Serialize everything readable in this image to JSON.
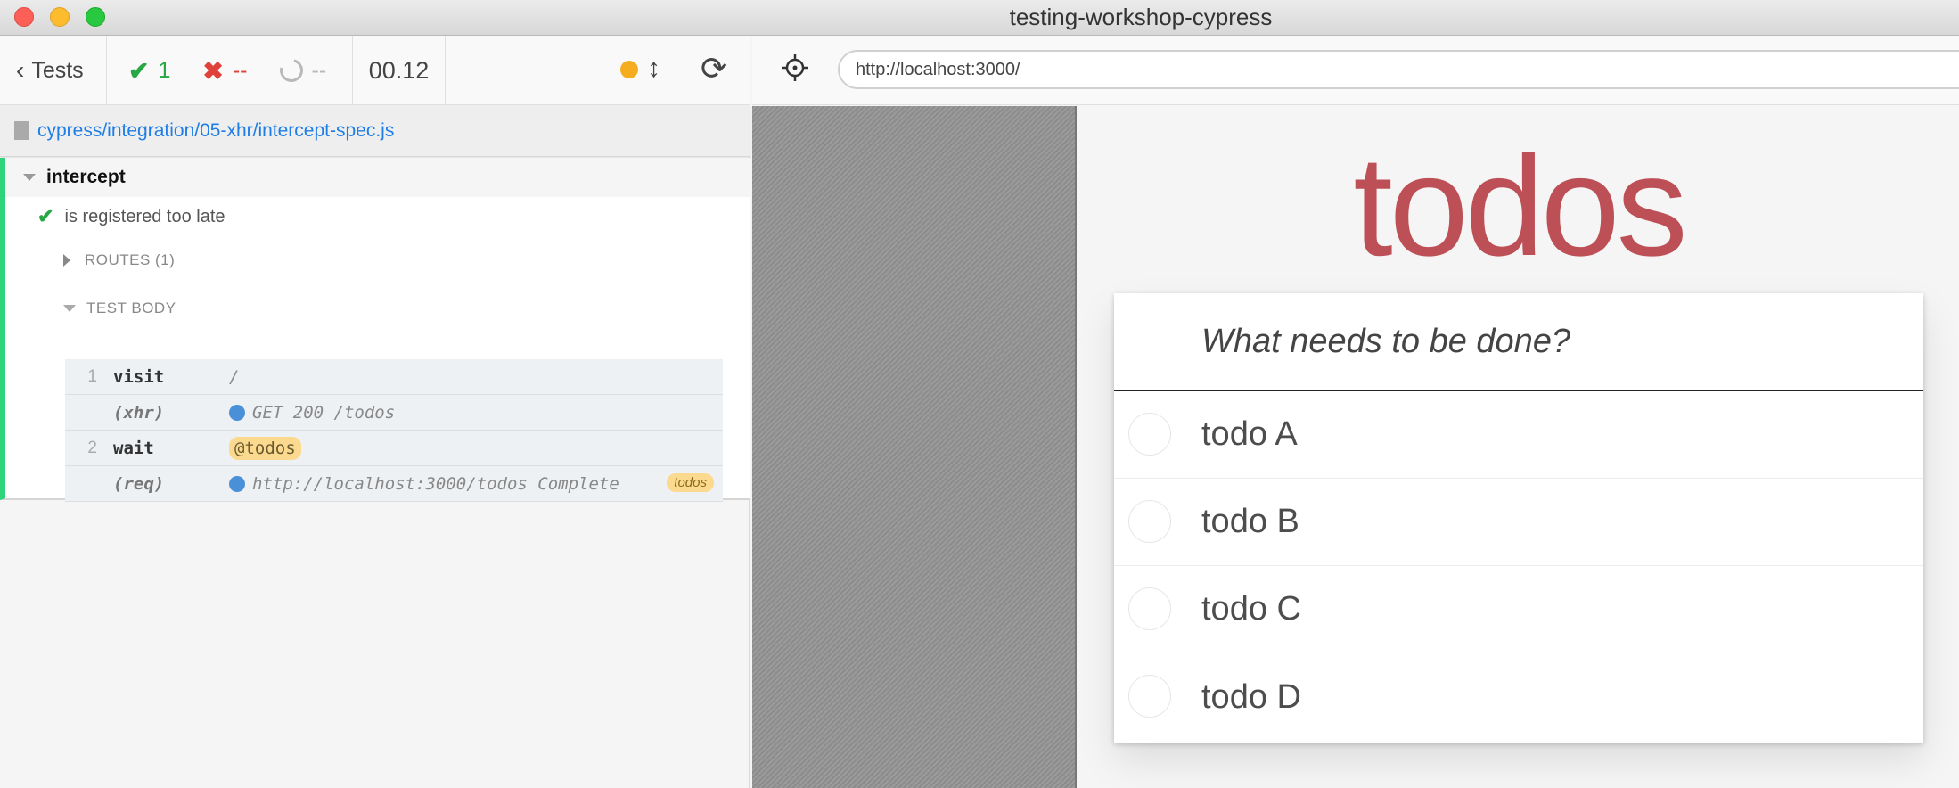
{
  "window": {
    "title": "testing-workshop-cypress"
  },
  "reporter": {
    "tests_label": "Tests",
    "stats": {
      "passed": "1",
      "failed": "--",
      "pending": "--"
    },
    "duration": "00.12",
    "spec_path": "cypress/integration/05-xhr/intercept-spec.js",
    "suite": {
      "title": "intercept"
    },
    "test": {
      "title": "is registered too late",
      "routes_label": "ROUTES (1)",
      "body_label": "TEST BODY",
      "commands": [
        {
          "num": "1",
          "name": "visit",
          "message": "/"
        },
        {
          "num": "",
          "name": "(xhr)",
          "message": "GET 200 /todos"
        },
        {
          "num": "2",
          "name": "wait",
          "message": "@todos"
        },
        {
          "num": "",
          "name": "(req)",
          "message": "http://localhost:3000/todos Complete",
          "alias": "todos"
        }
      ]
    },
    "colors": {
      "pass": "#28a745",
      "fail": "#e0413a",
      "accent": "#1e7de6",
      "running": "#f5ac1f"
    }
  },
  "aut": {
    "url": "http://localhost:3000/",
    "app_title": "todos",
    "new_todo_placeholder": "What needs to be done?",
    "todos": [
      "todo A",
      "todo B",
      "todo C",
      "todo D"
    ],
    "title_color": "#b83f45"
  }
}
